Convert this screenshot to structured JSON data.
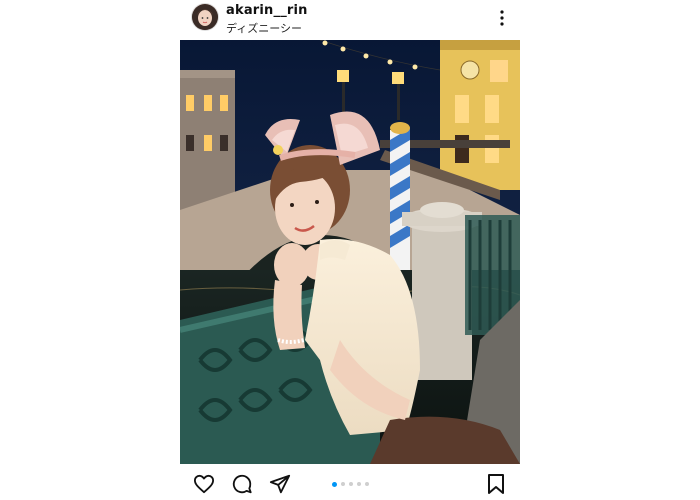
{
  "post": {
    "username": "akarin__rin",
    "location": "ディズニーシー",
    "carousel": {
      "total_slides": 5,
      "active_slide": 1
    }
  },
  "icons": {
    "more": "more-vertical-icon",
    "like": "heart-icon",
    "comment": "comment-icon",
    "share": "send-icon",
    "save": "bookmark-icon"
  },
  "colors": {
    "accent": "#0095f6",
    "text": "#111111",
    "inactive_dot": "#cfcfcf"
  }
}
